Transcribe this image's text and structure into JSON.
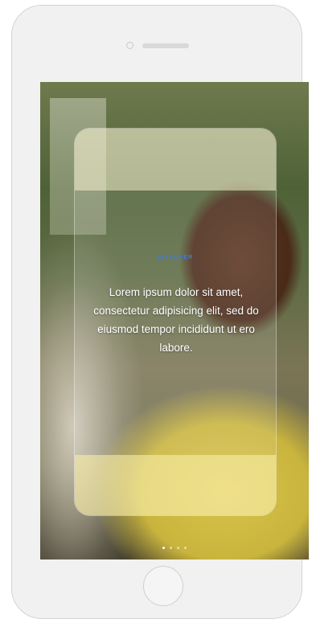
{
  "slide": {
    "label": "DISCOVER",
    "text": "Lorem ipsum dolor sit amet, consectetur adipisicing elit, sed do eiusmod tempor incididunt ut ero labore."
  },
  "pagination": {
    "count": 4,
    "active_index": 0
  },
  "colors": {
    "accent": "#3d7bd6",
    "phone_body": "#f1f1f1"
  }
}
